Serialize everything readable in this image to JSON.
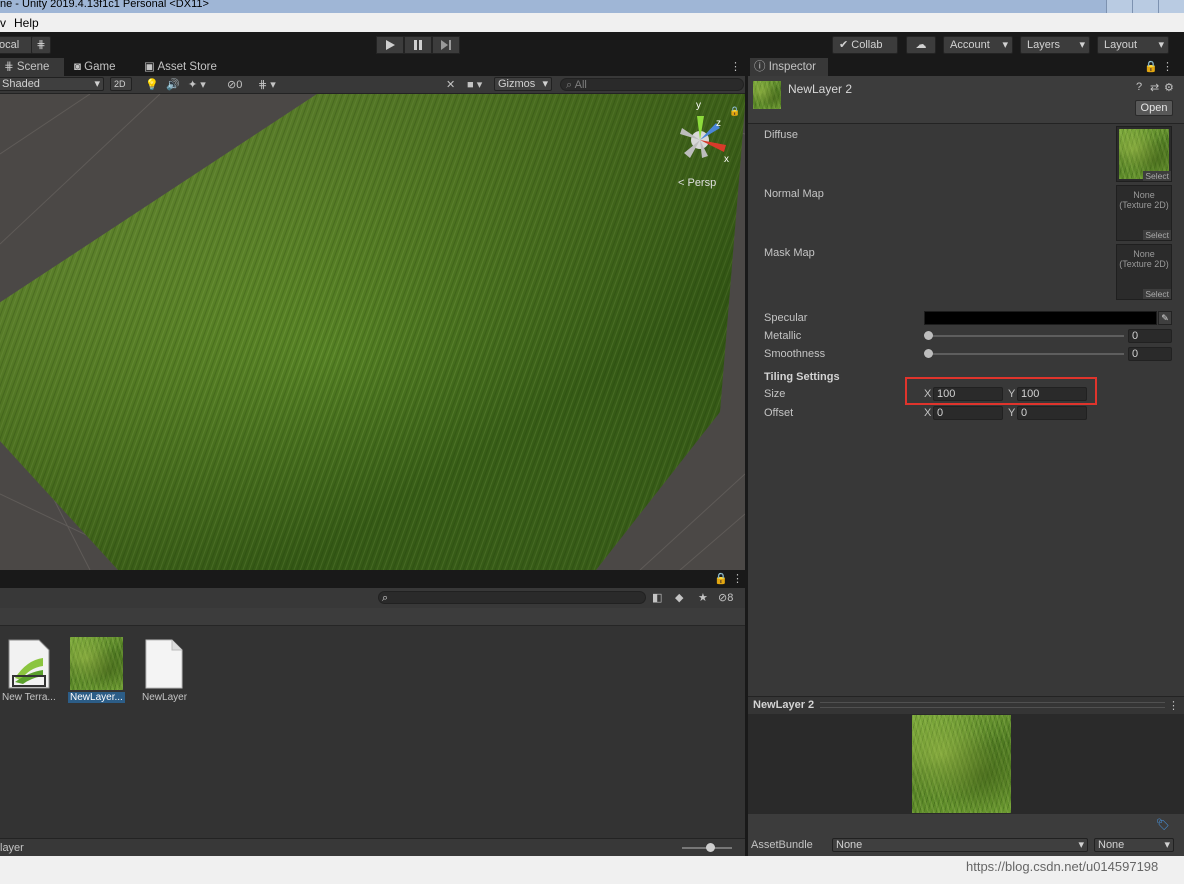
{
  "window": {
    "title": "ne - Unity 2019.4.13f1c1 Personal <DX11>"
  },
  "menu": [
    "v",
    "Help"
  ],
  "toolbar": {
    "local": "ocal",
    "collab": "Collab",
    "account": "Account",
    "layers": "Layers",
    "layout": "Layout"
  },
  "scene": {
    "tabs": [
      "Scene",
      "Game",
      "Asset Store"
    ],
    "shading": "Shaded",
    "mode2d": "2D",
    "hidden_count": "0",
    "gizmos": "Gizmos",
    "search_placeholder": "All",
    "gizmo_axes": {
      "y": "y",
      "z": "z",
      "x": "x"
    },
    "persp": "< Persp"
  },
  "project": {
    "hidden_count": "8",
    "items": [
      "New Terra...",
      "NewLayer...",
      "NewLayer"
    ],
    "footer_path": "layer"
  },
  "inspector": {
    "tab": "Inspector",
    "asset_name": "NewLayer 2",
    "open_button": "Open",
    "diffuse_label": "Diffuse",
    "normal_label": "Normal Map",
    "mask_label": "Mask Map",
    "none_texture": "None\n(Texture 2D)",
    "select": "Select",
    "specular_label": "Specular",
    "metallic_label": "Metallic",
    "metallic_value": "0",
    "smoothness_label": "Smoothness",
    "smoothness_value": "0",
    "tiling_header": "Tiling Settings",
    "size_label": "Size",
    "size_x": "100",
    "size_y": "100",
    "offset_label": "Offset",
    "offset_x": "0",
    "offset_y": "0",
    "axis_x": "X",
    "axis_y": "Y",
    "highlight_color": "#e0342c"
  },
  "preview": {
    "title": "NewLayer 2"
  },
  "assetbundle": {
    "label": "AssetBundle",
    "name": "None",
    "variant": "None"
  },
  "watermark": "https://blog.csdn.net/u014597198"
}
